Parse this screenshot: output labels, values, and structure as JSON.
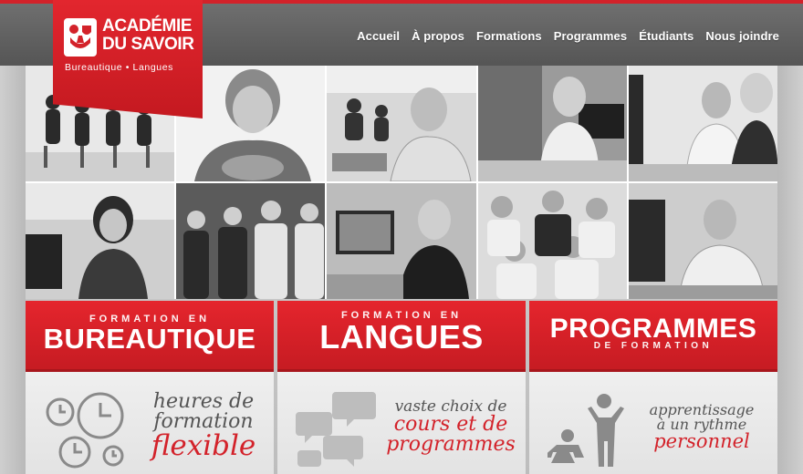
{
  "logo": {
    "line1": "ACADÉMIE",
    "line2": "DU SAVOIR",
    "tagline": "Bureautique • Langues"
  },
  "nav": [
    {
      "label": "Accueil"
    },
    {
      "label": "À propos"
    },
    {
      "label": "Formations"
    },
    {
      "label": "Programmes"
    },
    {
      "label": "Étudiants"
    },
    {
      "label": "Nous joindre"
    }
  ],
  "banners": [
    {
      "small": "FORMATION EN",
      "big": "BUREAUTIQUE"
    },
    {
      "small": "FORMATION EN",
      "big": "LANGUES"
    },
    {
      "big": "PROGRAMMES",
      "small": "DE FORMATION"
    }
  ],
  "features": [
    {
      "line1": "heures de",
      "line2": "formation",
      "line3": "flexible",
      "icon": "clocks-icon"
    },
    {
      "line1": "vaste choix de",
      "line2": "cours et de",
      "line3": "programmes",
      "icon": "speech-bubbles-icon"
    },
    {
      "line1": "apprentissage",
      "line2": "à un rythme",
      "line3": "personnel",
      "icon": "people-icon"
    }
  ],
  "colors": {
    "accent": "#d3222a",
    "topbar": "#5f5f5f",
    "text_gray": "#555555"
  }
}
